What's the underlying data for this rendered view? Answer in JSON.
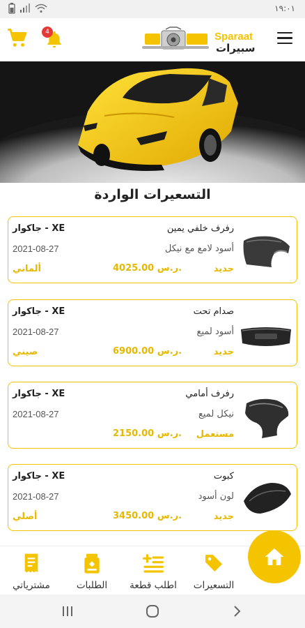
{
  "status_bar": {
    "time": "١٩:٠١"
  },
  "header": {
    "notification_count": "4",
    "logo_latin": "Sparaat",
    "logo_arabic": "سبيرات"
  },
  "section_title": "التسعيرات الواردة",
  "items": [
    {
      "name": "رفرف خلفي يمين",
      "desc": "أسود لامع مع نيكل",
      "condition": "جديد",
      "price": "4025.00 ر.س.",
      "vehicle": "جاكوار - XE",
      "date": "2021-08-27",
      "origin": "ألماني",
      "thumb_icon": "rear-fender-image"
    },
    {
      "name": "صدام تحت",
      "desc": "أسود لميع",
      "condition": "جديد",
      "price": "6900.00 ر.س.",
      "vehicle": "جاكوار - XE",
      "date": "2021-08-27",
      "origin": "صيني",
      "thumb_icon": "bumper-image"
    },
    {
      "name": "رفرف أمامي",
      "desc": "نيكل لميع",
      "condition": "مستعمل",
      "price": "2150.00 ر.س.",
      "vehicle": "جاكوار - XE",
      "date": "2021-08-27",
      "origin": "",
      "thumb_icon": "front-fender-image"
    },
    {
      "name": "كبوت",
      "desc": "لون أسود",
      "condition": "جديد",
      "price": "3450.00 ر.س.",
      "vehicle": "جاكوار - XE",
      "date": "2021-08-27",
      "origin": "أصلي",
      "thumb_icon": "hood-image"
    }
  ],
  "bottom_nav": {
    "pricing": {
      "label": "التسعيرات",
      "icon": "tag-icon"
    },
    "request_part": {
      "label": "اطلب قطعة",
      "icon": "add-list-icon"
    },
    "orders": {
      "label": "الطلبات",
      "icon": "orders-icon"
    },
    "purchases": {
      "label": "مشترياتي",
      "icon": "receipt-icon"
    },
    "home": {
      "icon": "home-icon"
    }
  },
  "colors": {
    "accent": "#F5C400",
    "text": "#222222",
    "badge": "#E53935"
  }
}
